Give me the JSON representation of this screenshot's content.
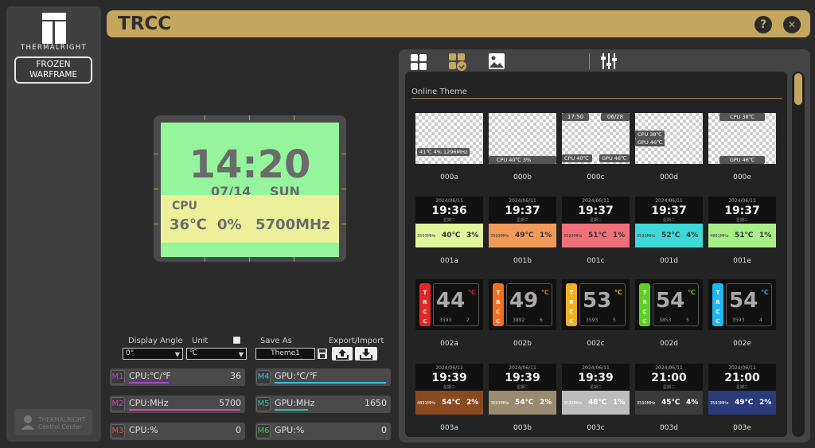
{
  "sidebar": {
    "logo_text": "THERMALRIGHT",
    "device_label": "FROZEN\nWARFRAME",
    "brand_label": "THERMALRIGHT\nControl Center"
  },
  "header": {
    "title": "TRCC",
    "help_label": "?",
    "close_label": "✕"
  },
  "preview": {
    "time": "14:20",
    "date": "07/14",
    "day": "SUN",
    "cpu_label": "CPU",
    "temp": "36℃",
    "util": "0%",
    "freq": "5700MHz"
  },
  "controls": {
    "display_angle_label": "Display Angle",
    "display_angle_value": "0°",
    "unit_label": "Unit",
    "unit_value": "℃",
    "save_as_label": "Save As",
    "save_as_value": "Theme1",
    "export_import_label": "Export/Import"
  },
  "metrics": [
    {
      "tag": "M1",
      "name": "CPU:℃/℉",
      "value": "36",
      "color": "#b040e0",
      "bar": 0.36
    },
    {
      "tag": "M2",
      "name": "CPU:MHz",
      "value": "5700",
      "color": "#e040c0",
      "bar": 1.0
    },
    {
      "tag": "M3",
      "name": "CPU:%",
      "value": "0",
      "color": "#e05050",
      "bar": 0
    },
    {
      "tag": "M4",
      "name": "GPU:℃/℉",
      "value": "",
      "color": "#30c0e0",
      "bar": 1.0
    },
    {
      "tag": "M5",
      "name": "GPU:MHz",
      "value": "1650",
      "color": "#30c0a0",
      "bar": 0.3
    },
    {
      "tag": "M6",
      "name": "GPU:%",
      "value": "0",
      "color": "#40c040",
      "bar": 0
    }
  ],
  "gallery": {
    "section_title": "Online Theme",
    "row0": {
      "names": [
        "000a",
        "000b",
        "000c",
        "000d",
        "000e"
      ],
      "a_cpu": "CPU",
      "a_vals": "41℃   4%   1296MHz",
      "b_vals": "CPU    40℃    3%",
      "c_time": "17:50",
      "c_date": "06/28",
      "c_cpu": "CPU 40℃",
      "c_gpu": "GPU 46℃",
      "d_cpu": "CPU 38℃",
      "d_gpu": "GPU 46℃",
      "e_cpu": "CPU  38℃",
      "e_gpu": "GPU  46℃"
    },
    "row1": [
      {
        "name": "001a",
        "date": "2024/06/11",
        "time": "19:36",
        "sub": "星期二",
        "freq": "3593MHz",
        "temp": "40℃",
        "util": "3%",
        "color": "#e2f59a"
      },
      {
        "name": "001b",
        "date": "2024/06/11",
        "time": "19:37",
        "sub": "星期二",
        "freq": "3593MHz",
        "temp": "49℃",
        "util": "1%",
        "color": "#f39a5a"
      },
      {
        "name": "001c",
        "date": "2024/06/11",
        "time": "19:37",
        "sub": "星期二",
        "freq": "3593MHz",
        "temp": "51℃",
        "util": "1%",
        "color": "#f0707a"
      },
      {
        "name": "001d",
        "date": "2024/06/11",
        "time": "19:37",
        "sub": "星期二",
        "freq": "3593MHz",
        "temp": "52℃",
        "util": "4%",
        "color": "#3fd8d8"
      },
      {
        "name": "001e",
        "date": "2024/06/11",
        "time": "19:37",
        "sub": "星期二",
        "freq": "4891MHz",
        "temp": "51℃",
        "util": "1%",
        "color": "#a8ef8a"
      }
    ],
    "row2": [
      {
        "name": "002a",
        "side": "TRCC",
        "temp": "44",
        "unit": "℃",
        "b1": "3593",
        "b2": "2",
        "color": "#e02828"
      },
      {
        "name": "002b",
        "side": "TRCC",
        "temp": "49",
        "unit": "℃",
        "b1": "3892",
        "b2": "6",
        "color": "#f07020"
      },
      {
        "name": "002c",
        "side": "TRCC",
        "temp": "53",
        "unit": "℃",
        "b1": "3593",
        "b2": "5",
        "color": "#f0b020"
      },
      {
        "name": "002d",
        "side": "TRCC",
        "temp": "54",
        "unit": "℃",
        "b1": "3853",
        "b2": "5",
        "color": "#60d020"
      },
      {
        "name": "002e",
        "side": "TRCC",
        "temp": "54",
        "unit": "℃",
        "b1": "3593",
        "b2": "4",
        "color": "#20b8f0"
      }
    ],
    "row3": [
      {
        "name": "003a",
        "date": "2024/06/11",
        "time": "19:39",
        "sub": "星期二",
        "freq": "4891MHz",
        "temp": "54℃",
        "util": "2%",
        "color": "#8a4a20"
      },
      {
        "name": "003b",
        "date": "2024/06/11",
        "time": "19:39",
        "sub": "星期二",
        "freq": "3593MHz",
        "temp": "54℃",
        "util": "2%",
        "color": "#9a8a70"
      },
      {
        "name": "003c",
        "date": "2024/06/11",
        "time": "19:39",
        "sub": "星期二",
        "freq": "3593MHz",
        "temp": "48℃",
        "util": "1%",
        "color": "#bcbcbc"
      },
      {
        "name": "003d",
        "date": "2024/06/11",
        "time": "21:00",
        "sub": "星期二",
        "freq": "3593MHz",
        "temp": "45℃",
        "util": "4%",
        "color": "#3a3a3a"
      },
      {
        "name": "003e",
        "date": "2024/06/11",
        "time": "21:00",
        "sub": "星期二",
        "freq": "3593MHz",
        "temp": "49℃",
        "util": "2%",
        "color": "#2a3a7a"
      }
    ]
  }
}
